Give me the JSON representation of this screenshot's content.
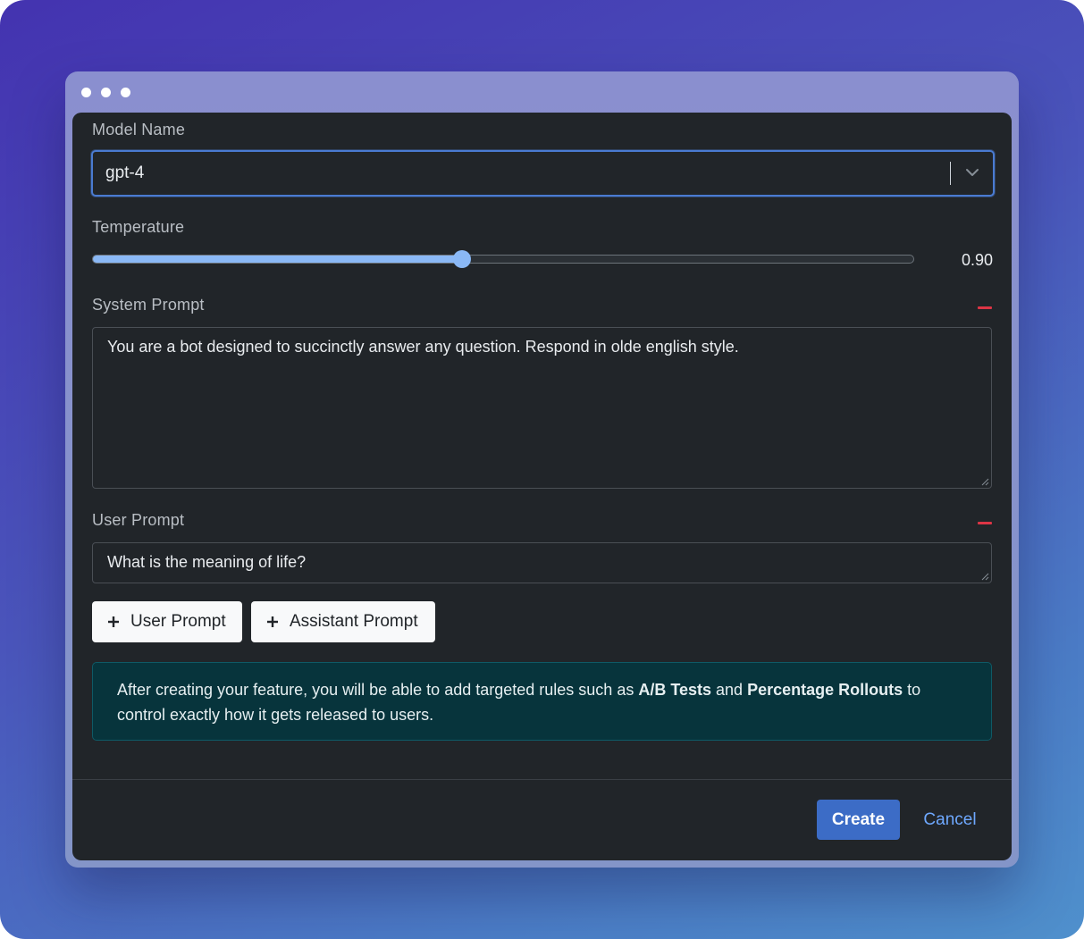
{
  "window": {
    "controls": [
      "dot",
      "dot",
      "dot"
    ]
  },
  "model": {
    "label": "Model Name",
    "value": "gpt-4"
  },
  "temperature": {
    "label": "Temperature",
    "value": 0.9,
    "display_value": "0.90",
    "fill_fraction": 0.45
  },
  "system_prompt": {
    "label": "System Prompt",
    "value": "You are a bot designed to succinctly answer any question. Respond in olde english style."
  },
  "user_prompt": {
    "label": "User Prompt",
    "value": "What is the meaning of life?"
  },
  "add_buttons": {
    "user": "User Prompt",
    "assistant": "Assistant Prompt"
  },
  "info": {
    "text_1": "After creating your feature, you will be able to add targeted rules such as ",
    "bold_1": "A/B Tests",
    "text_2": " and ",
    "bold_2": "Percentage Rollouts",
    "text_3": " to control exactly how it gets released to users."
  },
  "footer": {
    "create": "Create",
    "cancel": "Cancel"
  },
  "colors": {
    "primary": "#3c6cc6",
    "link": "#6ea8fe",
    "danger": "#dc3545",
    "slider": "#8ab8f5",
    "info_bg": "#07343c"
  }
}
